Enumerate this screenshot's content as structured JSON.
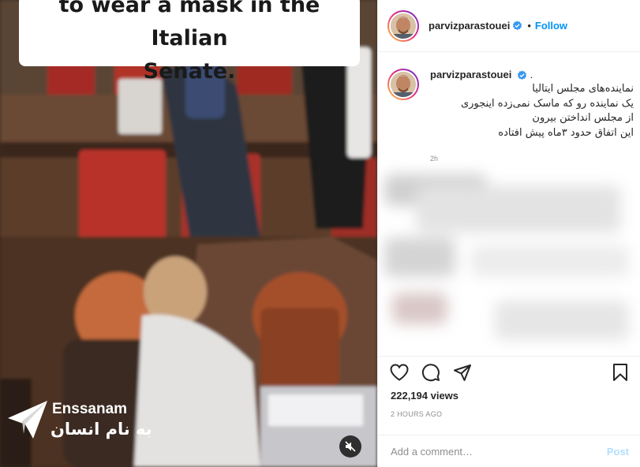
{
  "media": {
    "caption_line1": "to wear a mask in the Italian",
    "caption_line2": "Senate.",
    "watermark_latin": "Enssanam",
    "watermark_farsi": "به نام انسان",
    "mute_icon": "speaker-muted-icon"
  },
  "header": {
    "username": "parvizparastouei",
    "verified_icon": "verified-badge-icon",
    "separator": "•",
    "follow_label": "Follow"
  },
  "caption": {
    "username": "parvizparastouei",
    "trailing": ".",
    "lines": [
      "نماینده‌های مجلس ایتالیا",
      "یک نماینده رو که ماسک نمی‌زده اینجوری",
      "از مجلس انداختن بیرون",
      "این اتفاق حدود ۳ماه پیش افتاده"
    ],
    "age": "2h"
  },
  "actions": {
    "like_icon": "heart-icon",
    "comment_icon": "comment-icon",
    "share_icon": "send-icon",
    "save_icon": "bookmark-icon",
    "views": "222,194 views",
    "timestamp": "2 HOURS AGO"
  },
  "comment_box": {
    "placeholder": "Add a comment…",
    "post_label": "Post"
  },
  "colors": {
    "accent": "#0095f6",
    "post_disabled": "#b2dffc",
    "muted_text": "#8e8e8e",
    "border": "#efefef"
  }
}
